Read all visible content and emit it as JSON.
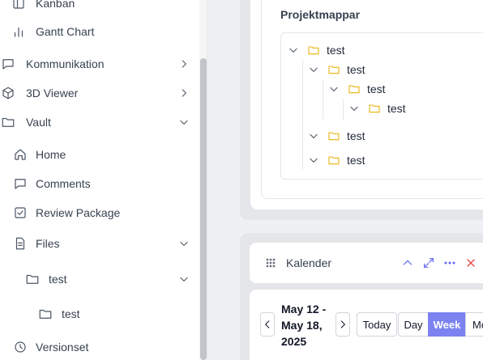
{
  "sidebar": {
    "items": [
      {
        "label": "Kanban",
        "icon": "kanban-icon"
      },
      {
        "label": "Gantt Chart",
        "icon": "bar-chart-icon"
      },
      {
        "label": "Kommunikation",
        "icon": "message-square-icon",
        "chevron": "right"
      },
      {
        "label": "3D Viewer",
        "icon": "cube-icon",
        "chevron": "right"
      },
      {
        "label": "Vault",
        "icon": "folder-icon",
        "chevron": "down"
      },
      {
        "label": "Home",
        "icon": "home-icon"
      },
      {
        "label": "Comments",
        "icon": "message-square-icon"
      },
      {
        "label": "Review Package",
        "icon": "check-square-icon"
      },
      {
        "label": "Files",
        "icon": "file-text-icon",
        "chevron": "down"
      },
      {
        "label": "test",
        "icon": "folder-icon",
        "chevron": "down"
      },
      {
        "label": "test",
        "icon": "folder-icon"
      },
      {
        "label": "Versionset",
        "icon": "clock-icon"
      }
    ]
  },
  "projektmappar": {
    "title": "Projektmappar",
    "tree": [
      {
        "label": "test",
        "level": 0
      },
      {
        "label": "test",
        "level": 1
      },
      {
        "label": "test",
        "level": 2
      },
      {
        "label": "test",
        "level": 3
      },
      {
        "label": "test",
        "level": 1
      },
      {
        "label": "test",
        "level": 1
      }
    ]
  },
  "kalender": {
    "title": "Kalender",
    "date_range": "May 12 - May 18, 2025",
    "today_label": "Today",
    "views": [
      "Day",
      "Week",
      "Mo"
    ],
    "active_view": "Week"
  },
  "colors": {
    "accent": "#7c83f0",
    "icon_blue": "#6366f1",
    "close_red": "#ef4444",
    "folder_yellow": "#eab308"
  }
}
